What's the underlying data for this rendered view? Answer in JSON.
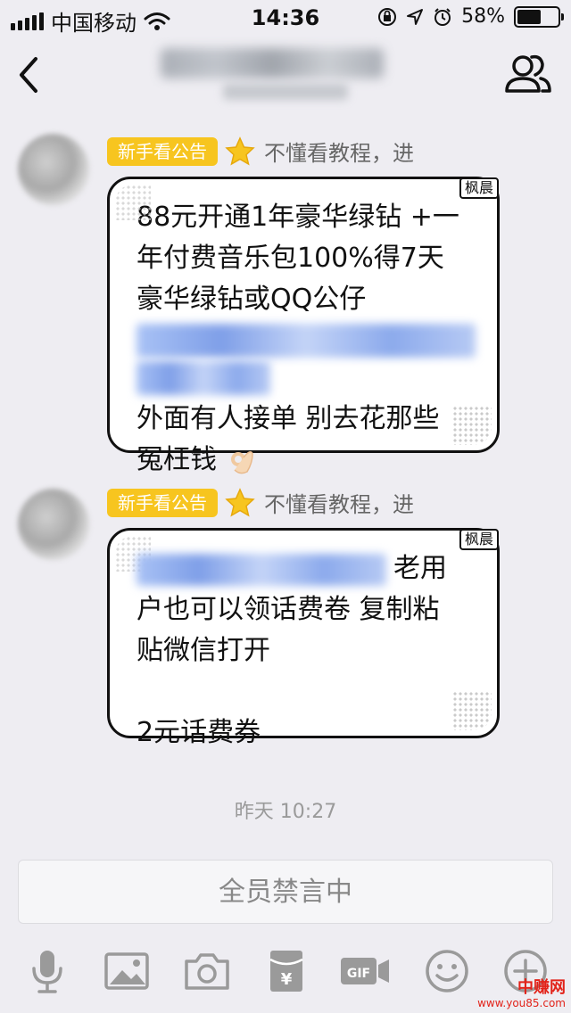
{
  "status_bar": {
    "carrier": "中国移动",
    "time": "14:36",
    "battery_percent": "58%",
    "battery_level": 0.58
  },
  "nav": {
    "back_icon": "chevron-left-icon",
    "members_icon": "group-members-icon"
  },
  "messages": [
    {
      "tag": "新手看公告",
      "nickname": "不懂看教程，进",
      "bubble_corner": "枫晨",
      "lines_before": [
        "88元开通1年豪华绿钻 +一",
        "年付费音乐包100%得7天",
        "豪华绿钻或QQ公仔"
      ],
      "lines_after": [
        "外面有人接单 别去花那些",
        "冤枉钱"
      ]
    },
    {
      "tag": "新手看公告",
      "nickname": "不懂看教程，进",
      "bubble_corner": "枫晨",
      "first_line_suffix": "老用",
      "lines": [
        "户也可以领话费卷 复制粘",
        "贴微信打开",
        "",
        "2元话费券"
      ]
    }
  ],
  "timestamp": "昨天 10:27",
  "muted_banner": "全员禁言中",
  "toolbar": [
    "microphone-icon",
    "image-icon",
    "camera-icon",
    "red-packet-icon",
    "gif-icon",
    "emoji-icon",
    "plus-icon"
  ],
  "watermark": {
    "main": "中赚网",
    "url": "www.you85.com"
  },
  "colors": {
    "background": "#eeedf2",
    "tag": "#f7c51f",
    "link_blur": "#8caaec",
    "watermark": "#e2231a"
  }
}
